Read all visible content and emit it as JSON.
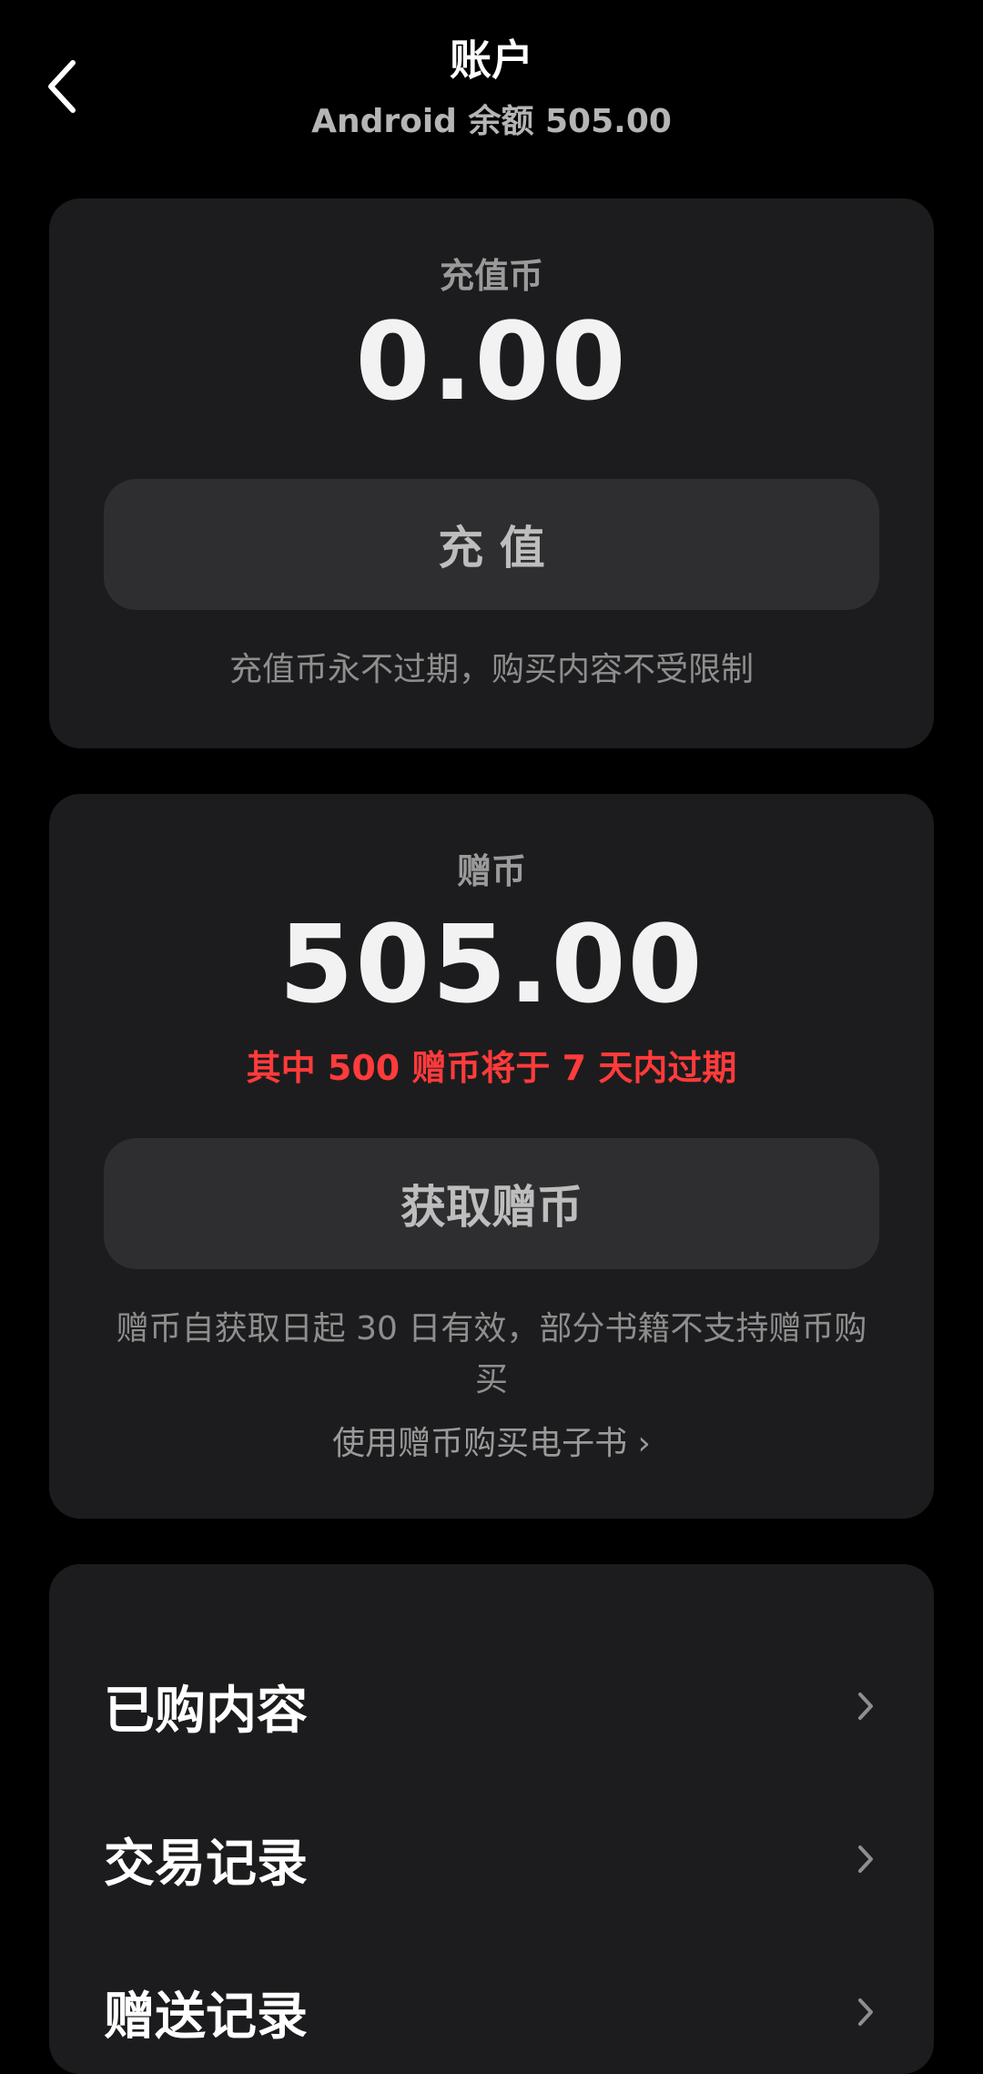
{
  "header": {
    "title": "账户",
    "subtitle": "Android 余额 505.00",
    "back_icon": "chevron-left-icon"
  },
  "recharge_card": {
    "label": "充值币",
    "amount": "0.00",
    "button_label": "充 值",
    "note": "充值币永不过期，购买内容不受限制"
  },
  "gift_card": {
    "label": "赠币",
    "amount": "505.00",
    "warning": "其中 500 赠币将于 7 天内过期",
    "warning_color": "#ff3b3b",
    "button_label": "获取赠币",
    "note": "赠币自获取日起 30 日有效，部分书籍不支持赠币购买",
    "link_label": "使用赠币购买电子书 ›"
  },
  "menu": {
    "items": [
      {
        "label": "已购内容",
        "icon": "chevron-right-icon"
      },
      {
        "label": "交易记录",
        "icon": "chevron-right-icon"
      },
      {
        "label": "赠送记录",
        "icon": "chevron-right-icon"
      }
    ]
  }
}
